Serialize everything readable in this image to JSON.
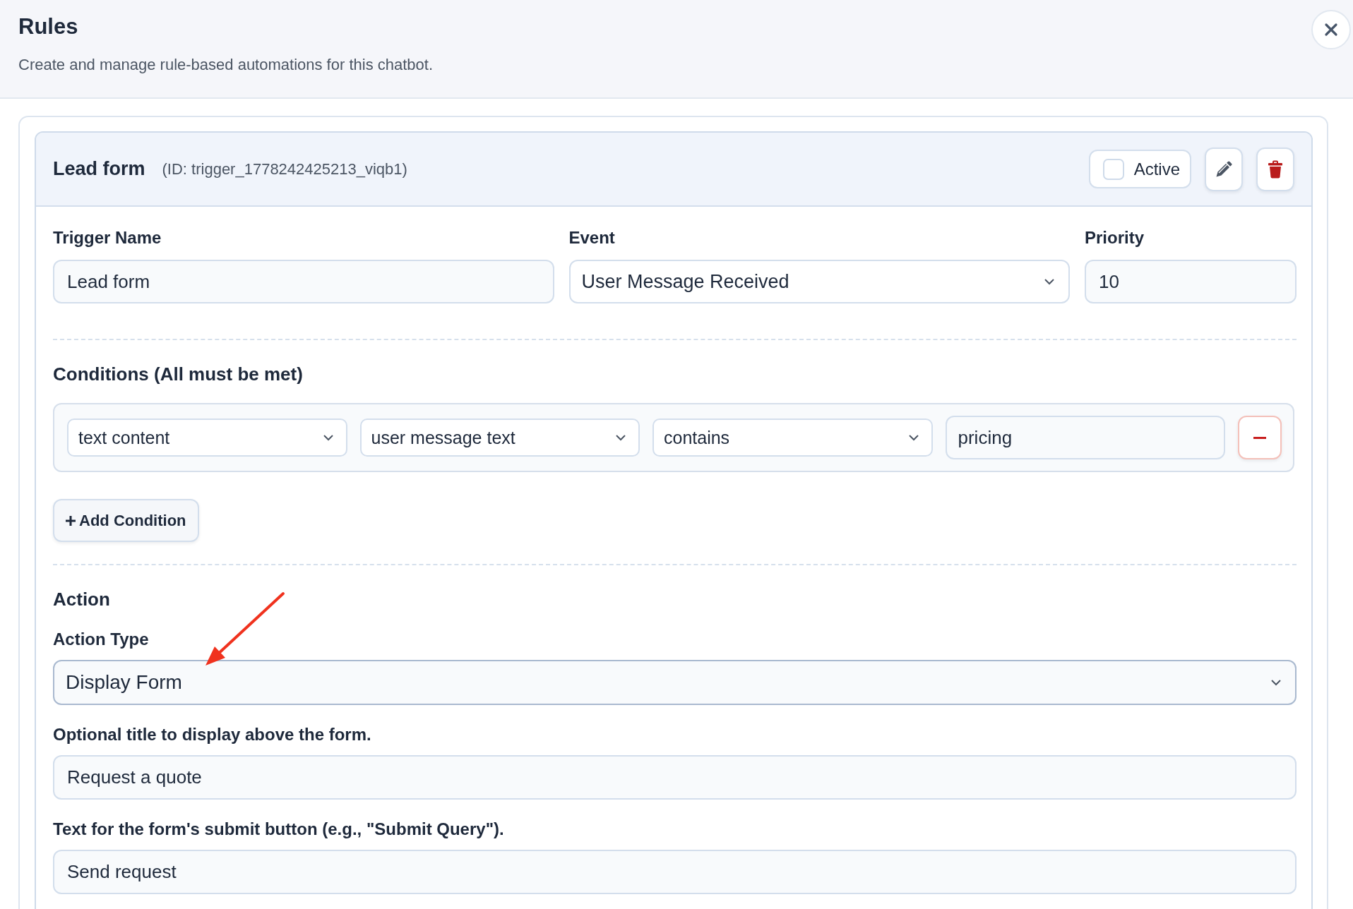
{
  "header": {
    "title": "Rules",
    "subtitle": "Create and manage rule-based automations for this chatbot."
  },
  "rule": {
    "name": "Lead form",
    "id_text": "(ID: trigger_1778242425213_viqb1)",
    "active": {
      "label": "Active",
      "checked": false
    },
    "fields": [
      {
        "label": "Trigger Name",
        "kind": "input",
        "value": "Lead form"
      },
      {
        "label": "Event",
        "kind": "select",
        "value": "User Message Received"
      },
      {
        "label": "Priority",
        "kind": "input",
        "value": "10"
      }
    ],
    "conditions_title": "Conditions (All must be met)",
    "conditions": [
      {
        "parts": [
          {
            "kind": "select",
            "value": "text content"
          },
          {
            "kind": "select",
            "value": "user message text"
          },
          {
            "kind": "select",
            "value": "contains"
          },
          {
            "kind": "input",
            "value": "pricing"
          }
        ]
      }
    ],
    "add_condition": {
      "label": "Add Condition"
    },
    "action": {
      "title": "Action",
      "fields": [
        {
          "label": "Action Type",
          "kind": "select",
          "value": "Display Form"
        },
        {
          "label": "Optional title to display above the form.",
          "kind": "input",
          "value": "Request a quote"
        },
        {
          "label": "Text for the form's submit button (e.g., \"Submit Query\").",
          "kind": "input",
          "value": "Send request"
        }
      ]
    }
  }
}
